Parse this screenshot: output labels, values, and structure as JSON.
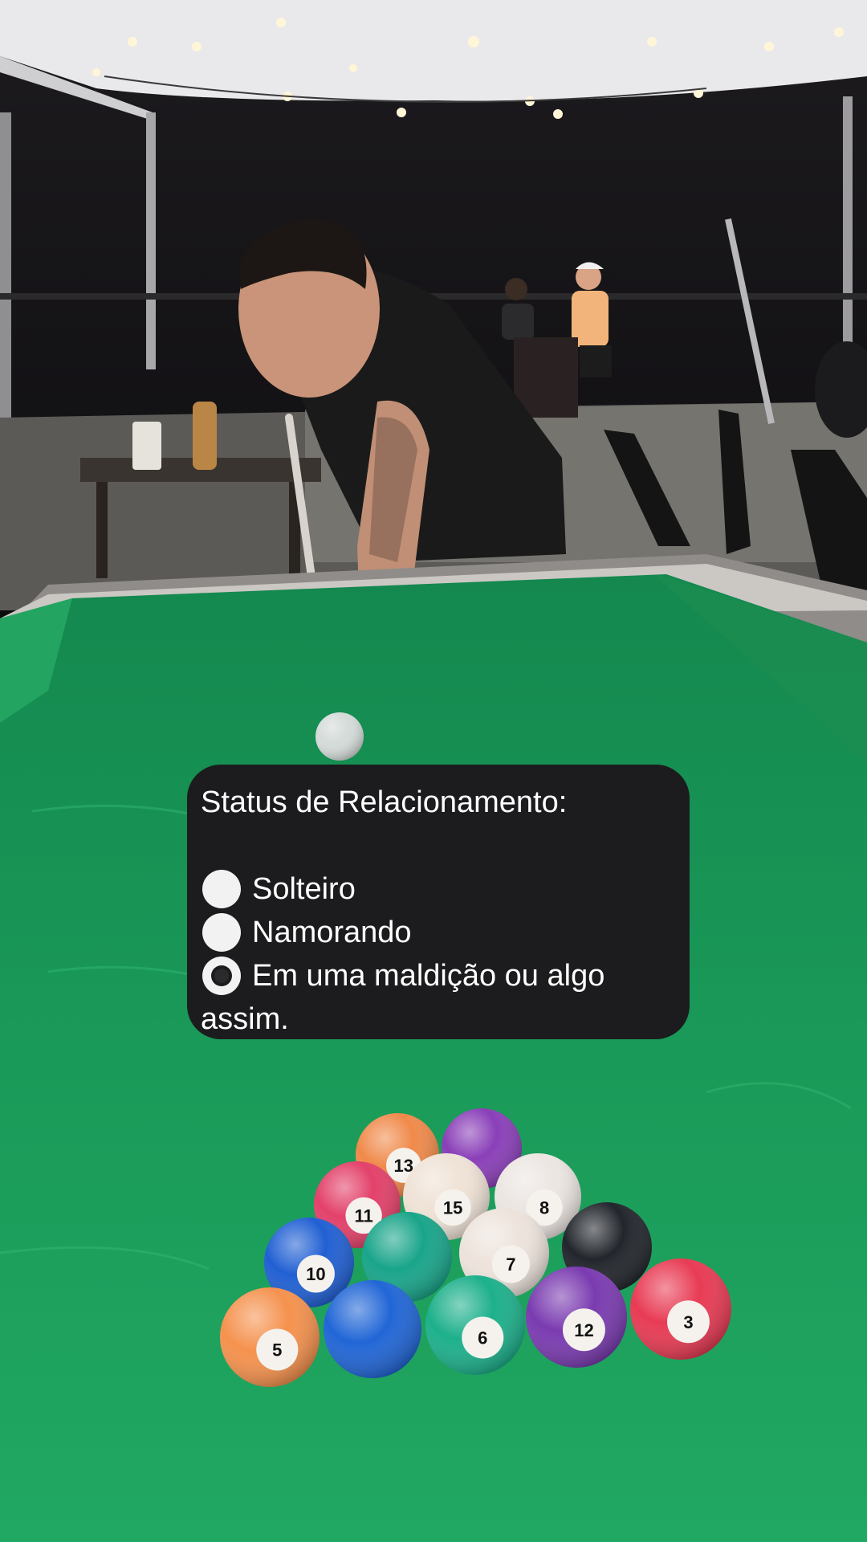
{
  "card": {
    "title": "Status de Relacionamento:",
    "options": [
      {
        "label": "Solteiro",
        "selected": false
      },
      {
        "label": "Namorando",
        "selected": false
      },
      {
        "label": "Em uma maldição ou algo",
        "continuation": "assim.",
        "selected": true
      }
    ]
  },
  "balls": [
    {
      "number": "13",
      "color": "#f08a4b"
    },
    {
      "number": "",
      "color": "#8a3fb8"
    },
    {
      "number": "11",
      "color": "#e3416a"
    },
    {
      "number": "15",
      "color": "#efe2d6"
    },
    {
      "number": "8",
      "color": "#ece6e2"
    },
    {
      "number": "10",
      "color": "#2160d3"
    },
    {
      "number": "",
      "color": "#19a58a"
    },
    {
      "number": "7",
      "color": "#ede3dc"
    },
    {
      "number": "",
      "color": "#22262c"
    },
    {
      "number": "5",
      "color": "#f5924e"
    },
    {
      "number": "",
      "color": "#2166d6"
    },
    {
      "number": "6",
      "color": "#1db08b"
    },
    {
      "number": "12",
      "color": "#7a3bb0"
    },
    {
      "number": "3",
      "color": "#e83b54"
    }
  ],
  "colors": {
    "felt": "#1f9a5a",
    "card_background": "#1c1c1e",
    "card_text": "#ffffff"
  }
}
